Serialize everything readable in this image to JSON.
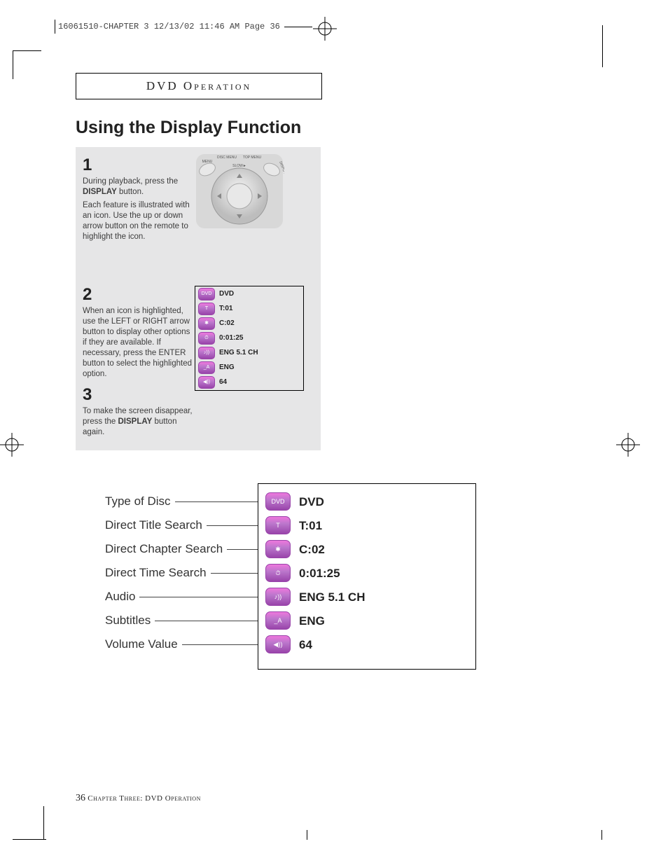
{
  "print_header": "16061510-CHAPTER 3  12/13/02 11:46 AM  Page 36",
  "section_title": "DVD Operation",
  "page_title": "Using the Display Function",
  "steps": {
    "one": {
      "num": "1",
      "p1a": "During playback, press the ",
      "p1b": "DISPLAY",
      "p1c": " button.",
      "p2": "Each feature is illustrated with an icon. Use the up or down arrow button on the remote to highlight the icon."
    },
    "two": {
      "num": "2",
      "p1": "When an icon is highlighted, use the LEFT or RIGHT arrow button to display other options if they are available. If necessary, press the ENTER button to select the highlighted option."
    },
    "three": {
      "num": "3",
      "p1a": "To make the screen disappear, press the ",
      "p1b": "DISPLAY",
      "p1c": " button again."
    }
  },
  "osd_items": [
    {
      "icon": "DVD",
      "text": "DVD"
    },
    {
      "icon": "T",
      "text": "T:01"
    },
    {
      "icon": "✱",
      "text": "C:02"
    },
    {
      "icon": "⏱",
      "text": "0:01:25"
    },
    {
      "icon": "♪))",
      "text": "ENG 5.1 CH"
    },
    {
      "icon": "_A",
      "text": "ENG"
    },
    {
      "icon": "◀))",
      "text": "64"
    }
  ],
  "labels": [
    "Type of Disc",
    "Direct Title Search",
    "Direct Chapter Search",
    "Direct Time Search",
    "Audio",
    "Subtitles",
    "Volume Value"
  ],
  "big_osd": [
    {
      "icon": "DVD",
      "text": "DVD"
    },
    {
      "icon": "T",
      "text": "T:01"
    },
    {
      "icon": "✱",
      "text": "C:02"
    },
    {
      "icon": "⏱",
      "text": "0:01:25"
    },
    {
      "icon": "♪))",
      "text": "ENG 5.1 CH"
    },
    {
      "icon": "_A",
      "text": "ENG"
    },
    {
      "icon": "◀))",
      "text": "64"
    }
  ],
  "footer": {
    "page_num": "36",
    "chapter": "Chapter Three: DVD Operation"
  },
  "remote_labels": {
    "menu": "MENU",
    "disc": "DISC MENU",
    "top": "TOP MENU",
    "disp": "DISPLAY",
    "slow": "SLOW"
  }
}
